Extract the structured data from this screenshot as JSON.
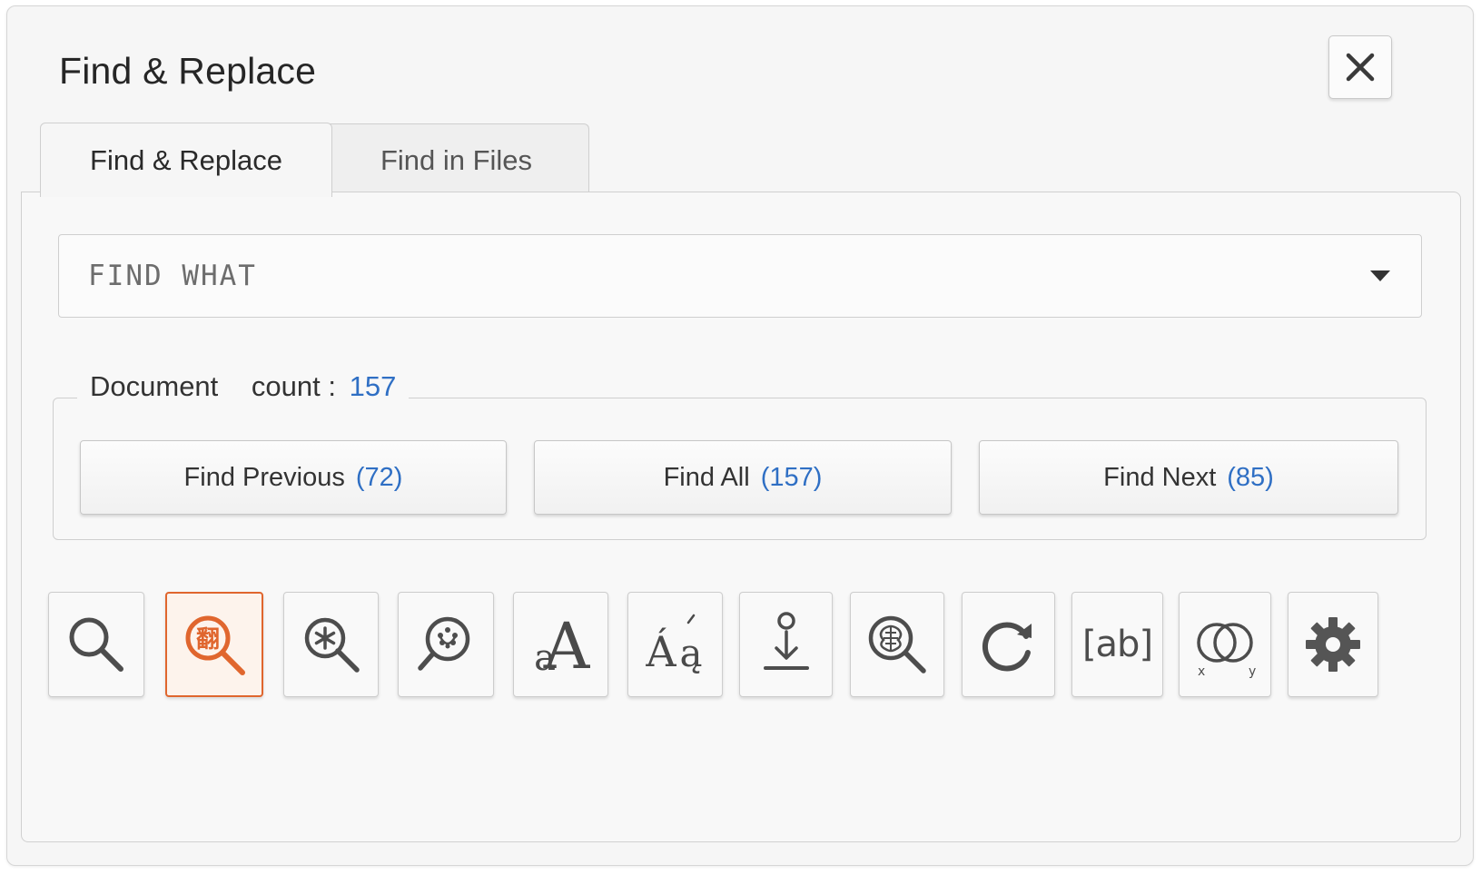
{
  "dialog": {
    "title": "Find & Replace",
    "close_icon": "close-icon"
  },
  "tabs": [
    {
      "label": "Find & Replace",
      "active": true
    },
    {
      "label": "Find in Files",
      "active": false
    }
  ],
  "find": {
    "placeholder": "FIND WHAT",
    "value": ""
  },
  "document_group": {
    "label": "Document",
    "count_label": "count :",
    "count_value": "157"
  },
  "buttons": {
    "previous": {
      "label": "Find Previous",
      "count": "(72)"
    },
    "all": {
      "label": "Find All",
      "count": "(157)"
    },
    "next": {
      "label": "Find Next",
      "count": "(85)"
    }
  },
  "toolbar_icons": [
    {
      "name": "search-icon",
      "selected": false
    },
    {
      "name": "chinese-search-icon",
      "selected": true,
      "glyph": "翻"
    },
    {
      "name": "wildcard-search-icon",
      "selected": false
    },
    {
      "name": "fuzzy-search-icon",
      "selected": false
    },
    {
      "name": "match-case-icon",
      "selected": false
    },
    {
      "name": "match-diacritics-icon",
      "selected": false
    },
    {
      "name": "find-in-selection-icon",
      "selected": false
    },
    {
      "name": "smart-search-icon",
      "selected": false
    },
    {
      "name": "wrap-around-icon",
      "selected": false
    },
    {
      "name": "whole-word-icon",
      "selected": false,
      "glyph": "[ab]"
    },
    {
      "name": "intersection-icon",
      "selected": false,
      "glyph_x": "x",
      "glyph_y": "y"
    },
    {
      "name": "settings-icon",
      "selected": false
    }
  ],
  "colors": {
    "accent_count": "#2f6fc4",
    "selected_icon": "#e0662e",
    "icon_gray": "#555555"
  }
}
